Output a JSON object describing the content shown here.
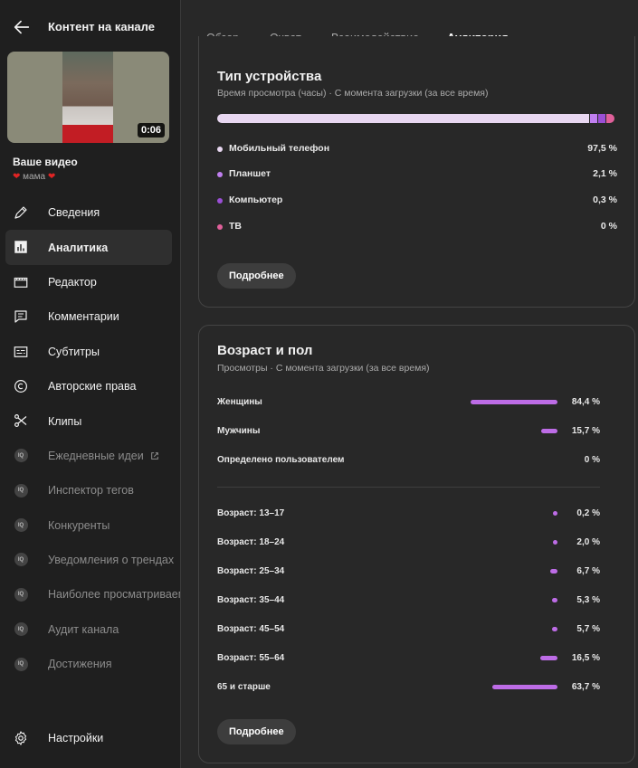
{
  "sidebar": {
    "title": "Контент на канале",
    "video": {
      "duration": "0:06",
      "title": "Ваше видео",
      "subtitle": "мама"
    },
    "items": [
      {
        "label": "Сведения",
        "icon": "pencil-icon"
      },
      {
        "label": "Аналитика",
        "icon": "analytics-icon"
      },
      {
        "label": "Редактор",
        "icon": "clapperboard-icon"
      },
      {
        "label": "Комментарии",
        "icon": "comment-icon"
      },
      {
        "label": "Субтитры",
        "icon": "subtitles-icon"
      },
      {
        "label": "Авторские права",
        "icon": "copyright-icon"
      },
      {
        "label": "Клипы",
        "icon": "scissors-icon"
      },
      {
        "label": "Ежедневные идеи",
        "icon": "iq-icon"
      },
      {
        "label": "Инспектор тегов",
        "icon": "iq-icon"
      },
      {
        "label": "Конкуренты",
        "icon": "iq-icon"
      },
      {
        "label": "Уведомления о трендах",
        "icon": "iq-icon"
      },
      {
        "label": "Наиболее просматриваемые",
        "icon": "iq-icon"
      },
      {
        "label": "Аудит канала",
        "icon": "iq-icon"
      },
      {
        "label": "Достижения",
        "icon": "iq-icon"
      }
    ],
    "iq_badge": "IQ",
    "settings_label": "Настройки"
  },
  "tabs": [
    "Обзор",
    "Охват",
    "Взаимодействие",
    "Аудитория"
  ],
  "active_tab": "Аудитория",
  "device_card": {
    "title": "Тип устройства",
    "subtitle": "Время просмотра (часы) · С момента загрузки (за все время)",
    "rows": [
      {
        "label": "Мобильный телефон",
        "value": "97,5 %",
        "share": 97.5,
        "color": "#e8d7f1"
      },
      {
        "label": "Планшет",
        "value": "2,1 %",
        "share": 2.1,
        "color": "#c07ff0"
      },
      {
        "label": "Компьютер",
        "value": "0,3 %",
        "share": 0.3,
        "color": "#9b4fd6"
      },
      {
        "label": "ТВ",
        "value": "0 %",
        "share": 0,
        "color": "#e0609a"
      }
    ],
    "button": "Подробнее"
  },
  "age_card": {
    "title": "Возраст и пол",
    "subtitle": "Просмотры · С момента загрузки (за все время)",
    "gender": [
      {
        "label": "Женщины",
        "value": "84,4 %",
        "share": 84.4
      },
      {
        "label": "Мужчины",
        "value": "15,7 %",
        "share": 15.7
      },
      {
        "label": "Определено пользователем",
        "value": "0 %",
        "share": 0
      }
    ],
    "age": [
      {
        "label": "Возраст: 13–17",
        "value": "0,2 %",
        "share": 0.2
      },
      {
        "label": "Возраст: 18–24",
        "value": "2,0 %",
        "share": 2.0
      },
      {
        "label": "Возраст: 25–34",
        "value": "6,7 %",
        "share": 6.7
      },
      {
        "label": "Возраст: 35–44",
        "value": "5,3 %",
        "share": 5.3
      },
      {
        "label": "Возраст: 45–54",
        "value": "5,7 %",
        "share": 5.7
      },
      {
        "label": "Возраст: 55–64",
        "value": "16,5 %",
        "share": 16.5
      },
      {
        "label": "65 и старше",
        "value": "63,7 %",
        "share": 63.7
      }
    ],
    "button": "Подробнее",
    "bar_color": "#bd6ce6"
  }
}
